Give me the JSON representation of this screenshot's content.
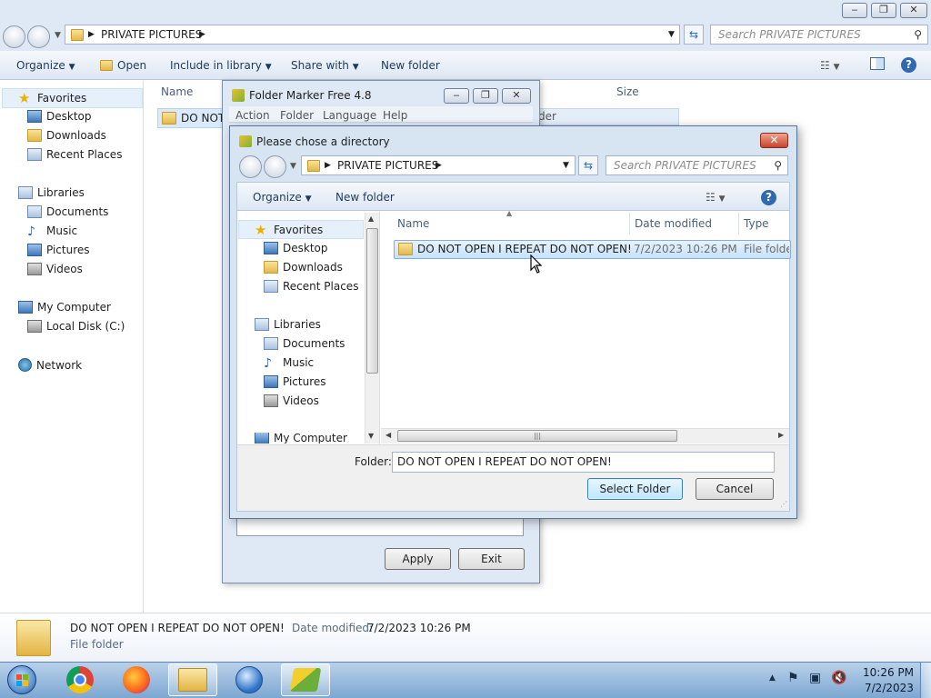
{
  "explorer": {
    "address_path": "PRIVATE PICTURES",
    "search_placeholder": "Search PRIVATE PICTURES",
    "toolbar": {
      "organize": "Organize",
      "open": "Open",
      "include_in_library": "Include in library",
      "share_with": "Share with",
      "new_folder": "New folder"
    },
    "columns": {
      "name": "Name",
      "size": "Size"
    },
    "file_partial": "DO NOT",
    "behind_partial_text": "der",
    "nav": {
      "favorites": "Favorites",
      "desktop": "Desktop",
      "downloads": "Downloads",
      "recent_places": "Recent Places",
      "libraries": "Libraries",
      "documents": "Documents",
      "music": "Music",
      "pictures": "Pictures",
      "videos": "Videos",
      "my_computer": "My Computer",
      "local_disk": "Local Disk (C:)",
      "network": "Network"
    },
    "details": {
      "name": "DO NOT OPEN I REPEAT DO NOT OPEN!",
      "date_label": "Date modified:",
      "date_value": "7/2/2023 10:26 PM",
      "type": "File folder"
    }
  },
  "folder_marker": {
    "title": "Folder Marker Free 4.8",
    "menu": [
      "Action",
      "Folder",
      "Language",
      "Help"
    ],
    "apply": "Apply",
    "exit": "Exit"
  },
  "dialog": {
    "title": "Please chose a directory",
    "address_path": "PRIVATE PICTURES",
    "search_placeholder": "Search PRIVATE PICTURES",
    "toolbar": {
      "organize": "Organize",
      "new_folder": "New folder"
    },
    "nav": {
      "favorites": "Favorites",
      "desktop": "Desktop",
      "downloads": "Downloads",
      "recent_places": "Recent Places",
      "libraries": "Libraries",
      "documents": "Documents",
      "music": "Music",
      "pictures": "Pictures",
      "videos": "Videos",
      "my_computer": "My Computer"
    },
    "columns": {
      "name": "Name",
      "date_modified": "Date modified",
      "type": "Type"
    },
    "row": {
      "name": "DO NOT OPEN I REPEAT DO NOT OPEN!",
      "date": "7/2/2023 10:26 PM",
      "type": "File folder"
    },
    "folder_label": "Folder:",
    "folder_value": "DO NOT OPEN I REPEAT DO NOT OPEN!",
    "select_folder": "Select Folder",
    "cancel": "Cancel"
  },
  "taskbar": {
    "clock_time": "10:26 PM",
    "clock_date": "7/2/2023"
  }
}
